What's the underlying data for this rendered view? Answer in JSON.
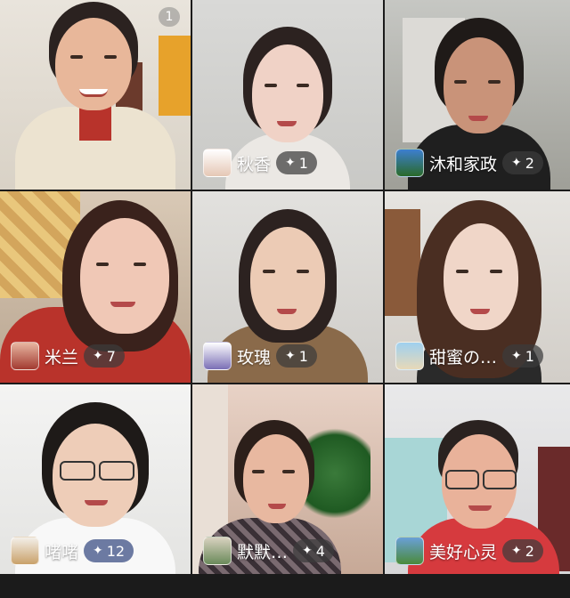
{
  "tiles": [
    {
      "name": "",
      "badge": "",
      "corner": "1"
    },
    {
      "name": "秋香",
      "badge": "1"
    },
    {
      "name": "沐和家政",
      "badge": "2"
    },
    {
      "name": "米兰",
      "badge": "7"
    },
    {
      "name": "玫瑰",
      "badge": "1"
    },
    {
      "name": "甜蜜の…",
      "badge": "1"
    },
    {
      "name": "啫啫",
      "badge": "12"
    },
    {
      "name": "默默…",
      "badge": "4"
    },
    {
      "name": "美好心灵",
      "badge": "2"
    }
  ],
  "icons": {
    "sparkle": "sparkle-icon"
  },
  "colors": {
    "badge_bg": "#3c3c3c",
    "badge_blue": "#485a8c",
    "background": "#1b1b1b"
  }
}
